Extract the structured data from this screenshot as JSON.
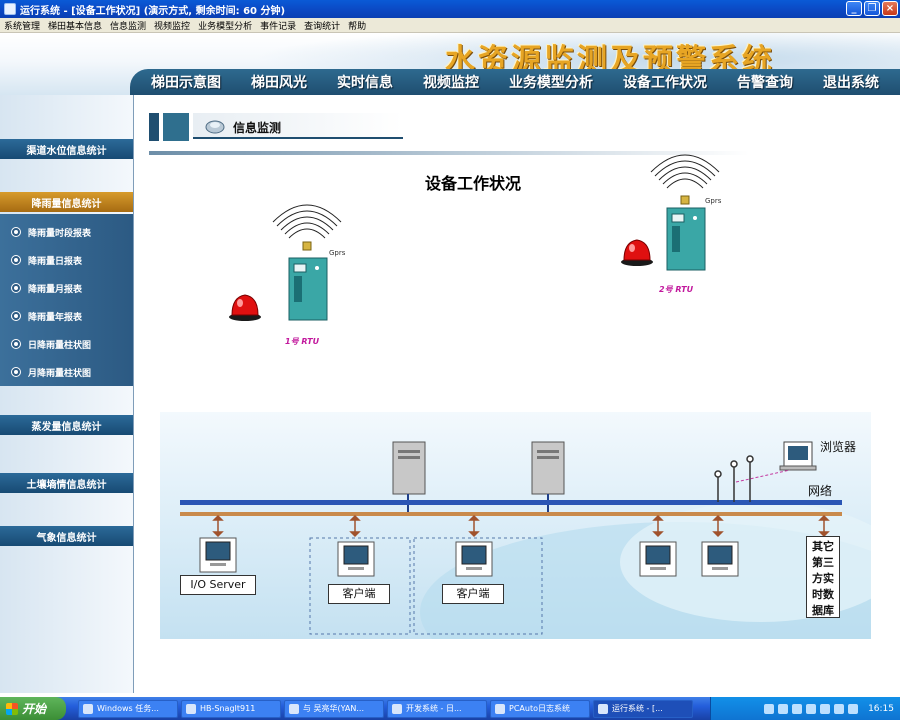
{
  "window": {
    "title": "运行系统 - [设备工作状况] (演示方式, 剩余时间: 60 分钟)",
    "controls": [
      "minimize",
      "restore",
      "close"
    ]
  },
  "menubar": [
    "系统管理",
    "梯田基本信息",
    "信息监测",
    "视频监控",
    "业务模型分析",
    "事件记录",
    "查询统计",
    "帮助"
  ],
  "banner": {
    "brand": "水资源监测及预警系统"
  },
  "nav": [
    "梯田示意图",
    "梯田风光",
    "实时信息",
    "视频监控",
    "业务模型分析",
    "设备工作状况",
    "告警查询",
    "退出系统"
  ],
  "sidebar": {
    "categories": [
      {
        "label": "渠道水位信息统计",
        "active": false
      },
      {
        "label": "降雨量信息统计",
        "active": true
      },
      {
        "label": "蒸发量信息统计",
        "active": false
      },
      {
        "label": "土壤墒情信息统计",
        "active": false
      },
      {
        "label": "气象信息统计",
        "active": false
      }
    ],
    "subitems": [
      "降雨量时段报表",
      "降雨量日报表",
      "降雨量月报表",
      "降雨量年报表",
      "日降雨量柱状图",
      "月降雨量柱状图"
    ]
  },
  "section": {
    "label": "信息监测"
  },
  "page": {
    "title": "设备工作状况"
  },
  "rtus": [
    {
      "caption": "1号 RTU",
      "antenna": "Gprs"
    },
    {
      "caption": "2号 RTU",
      "antenna": "Gprs"
    }
  ],
  "network": {
    "browser_label": "浏览器",
    "network_label": "网络",
    "io_server": "I/O Server",
    "client_1": "客户端",
    "client_2": "客户端",
    "other_db": "其它第三方实时数据库"
  },
  "taskbar": {
    "start": "开始",
    "tasks": [
      "Windows 任务...",
      "HB-SnagIt911",
      "与 吴亮华(YAN...",
      "开发系统 - 日...",
      "PCAuto日志系统",
      "运行系统 - [..."
    ],
    "clock": "16:15"
  },
  "colors": {
    "nav_bar": "#1f4e70",
    "active_category": "#d79b2c",
    "rtu_caption": "#c2199d",
    "brand_gold": "#e7a524"
  }
}
